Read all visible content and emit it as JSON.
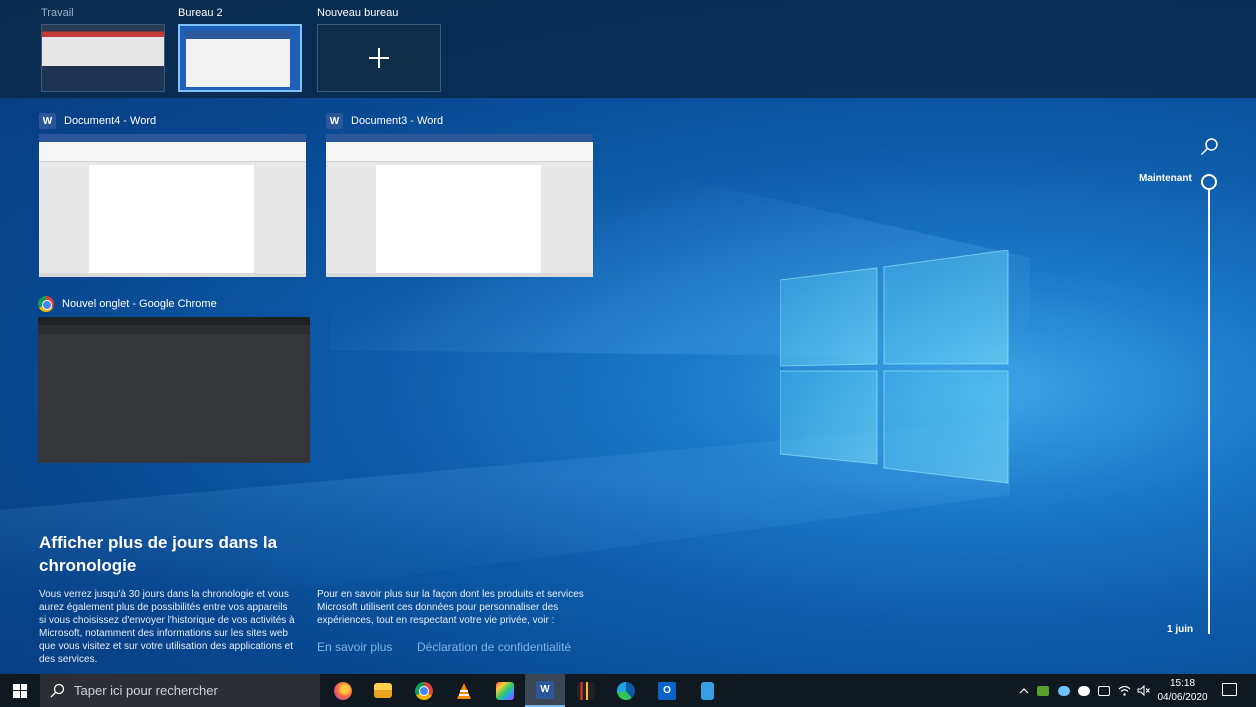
{
  "desktops": [
    {
      "label": "Travail",
      "active": false
    },
    {
      "label": "Bureau 2",
      "active": true
    },
    {
      "label": "Nouveau bureau",
      "active": false
    }
  ],
  "windows": [
    {
      "title": "Document4 - Word",
      "app_icon": "word-icon"
    },
    {
      "title": "Document3 - Word",
      "app_icon": "word-icon"
    },
    {
      "title": "Nouvel onglet - Google Chrome",
      "app_icon": "chrome-icon"
    }
  ],
  "timeline": {
    "now_label": "Maintenant",
    "date_label": "1 juin"
  },
  "promo": {
    "title": "Afficher plus de jours dans la chronologie",
    "text_left": "Vous verrez jusqu'à 30 jours dans la chronologie et vous aurez également plus de possibilités entre vos appareils si vous choisissez d'envoyer l'historique de vos activités à Microsoft, notamment des informations sur les sites web que vous visitez et sur votre utilisation des applications et des services.",
    "text_right": "Pour en savoir plus sur la façon dont les produits et services Microsoft utilisent ces données pour personnaliser des expériences, tout en respectant votre vie privée, voir :",
    "link_learn_more": "En savoir plus",
    "link_privacy": "Déclaration de confidentialité"
  },
  "taskbar": {
    "search_placeholder": "Taper ici pour rechercher",
    "pinned_apps": [
      "firefox-icon",
      "file-explorer-icon",
      "chrome-icon",
      "vlc-icon",
      "photos-icon",
      "word-icon",
      "audio-app-icon",
      "edge-icon",
      "outlook-icon",
      "notepad-icon"
    ],
    "active_app": "word-icon",
    "clock_time": "15:18",
    "clock_date": "04/06/2020"
  },
  "colors": {
    "accent": "#7fc3ff",
    "word": "#2b579a",
    "link": "#7fb4e6"
  }
}
